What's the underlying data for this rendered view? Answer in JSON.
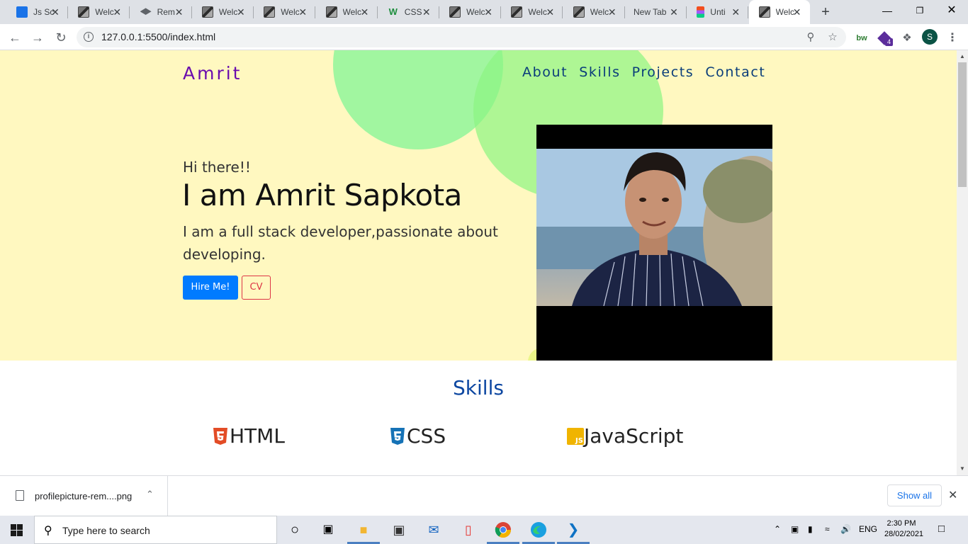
{
  "browser": {
    "tabs": [
      {
        "title": "Js Sc",
        "icon": "flag-icon",
        "active": false
      },
      {
        "title": "Welc",
        "icon": "image-icon",
        "active": false
      },
      {
        "title": "Rem",
        "icon": "graduation-cap-icon",
        "active": false
      },
      {
        "title": "Welc",
        "icon": "image-icon",
        "active": false
      },
      {
        "title": "Welc",
        "icon": "image-icon",
        "active": false
      },
      {
        "title": "Welc",
        "icon": "image-icon",
        "active": false
      },
      {
        "title": "CSS",
        "icon": "w3-icon",
        "active": false
      },
      {
        "title": "Welc",
        "icon": "image-icon",
        "active": false
      },
      {
        "title": "Welc",
        "icon": "image-icon",
        "active": false
      },
      {
        "title": "Welc",
        "icon": "image-icon",
        "active": false
      },
      {
        "title": "New Tab",
        "icon": "",
        "active": false
      },
      {
        "title": "Unti",
        "icon": "figma-icon",
        "active": false
      },
      {
        "title": "Welc",
        "icon": "image-icon",
        "active": true
      }
    ],
    "url": "127.0.0.1:5500/index.html",
    "profile_initial": "S",
    "extension_badge": "4"
  },
  "site": {
    "brand": "Amrit",
    "nav": [
      "About",
      "Skills",
      "Projects",
      "Contact"
    ],
    "greeting": "Hi there!!",
    "name": "I am Amrit Sapkota",
    "tagline": "I am a full stack developer,passionate about developing.",
    "hire_button": "Hire Me!",
    "cv_button": "CV",
    "skills_title": "Skills",
    "skills": [
      {
        "label": "HTML",
        "icon": "html5-icon",
        "color": "#e34c26"
      },
      {
        "label": "CSS",
        "icon": "css3-icon",
        "color": "#1572b6"
      },
      {
        "label": "JavaScript",
        "icon": "js-icon",
        "color": "#f0b400"
      }
    ],
    "colors": {
      "hero_bg": "#fff8c0",
      "brand": "#6a0dad",
      "nav": "#0a3d7a",
      "skills_title": "#0d47a1",
      "hire": "#007bff",
      "cv": "#dc3545"
    }
  },
  "downloads": {
    "file": "profilepicture-rem....png",
    "show_all": "Show all"
  },
  "taskbar": {
    "search_placeholder": "Type here to search",
    "language": "ENG",
    "time": "2:30 PM",
    "date": "28/02/2021"
  }
}
